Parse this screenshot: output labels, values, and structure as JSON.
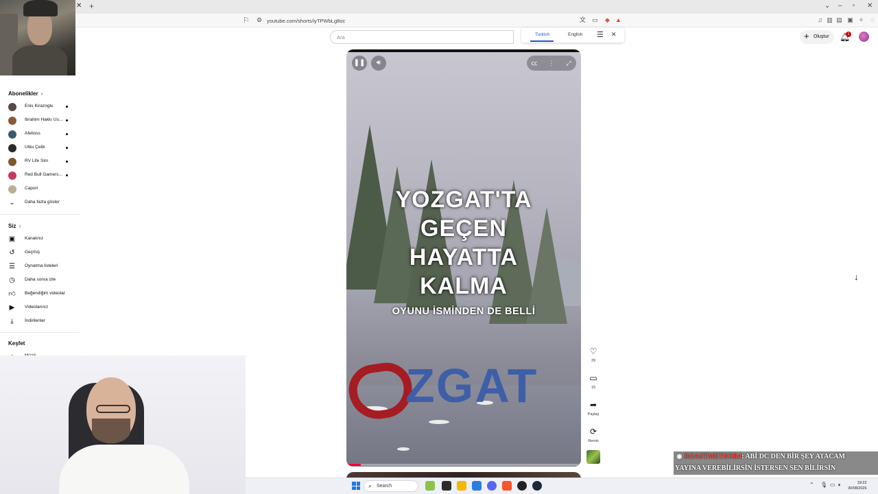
{
  "browser": {
    "url": "youtube.com/shorts/iyTPWbLg8oc"
  },
  "search": {
    "placeholder": "Ara"
  },
  "caption_menu": {
    "languages": [
      "Turkish",
      "English"
    ],
    "active": "Turkish"
  },
  "header": {
    "create_label": "Oluştur",
    "notification_count": "1"
  },
  "sidebar": {
    "subscriptions_title": "Abonelikler",
    "subscriptions": [
      {
        "label": "Enis Kirazoglu",
        "color": "#5a4a44",
        "new": true
      },
      {
        "label": "İbrahim Hakkı Us...",
        "color": "#8a5a3c",
        "new": true
      },
      {
        "label": "Afelioss",
        "color": "#3b5a6a",
        "new": true
      },
      {
        "label": "Utku Çelik",
        "color": "#2a2a2a",
        "new": true
      },
      {
        "label": "RV Life Sim",
        "color": "#7a5a2a",
        "new": true
      },
      {
        "label": "Red Bull Gamers...",
        "color": "#c43a5a",
        "new": true
      },
      {
        "label": "Capori",
        "color": "#b8b090",
        "new": false
      }
    ],
    "show_more": "Daha fazla göster",
    "you_title": "Siz",
    "you_items": [
      {
        "label": "Kanalınız",
        "icon": "account-box-icon"
      },
      {
        "label": "Geçmiş",
        "icon": "history-icon"
      },
      {
        "label": "Oynatma listeleri",
        "icon": "playlist-icon"
      },
      {
        "label": "Daha sonra izle",
        "icon": "clock-icon"
      },
      {
        "label": "Beğendiğim videolar",
        "icon": "thumbs-up-icon"
      },
      {
        "label": "Videolarınız",
        "icon": "video-icon"
      },
      {
        "label": "İndirilenler",
        "icon": "download-icon"
      }
    ],
    "explore_title": "Keşfet",
    "explore_items": [
      {
        "label": "Müzik",
        "icon": "music-icon"
      }
    ]
  },
  "player": {
    "overlay_lines": [
      "YOZGAT'TA",
      "GEÇEN",
      "HAYATTA",
      "KALMA"
    ],
    "overlay_sub": "OYUNU İSMİNDEN DE BELLİ",
    "sign_text": "ZGAT",
    "progress": 0.06
  },
  "actions": {
    "likes": "29",
    "comments": "15",
    "share_label": "Paylaş",
    "remix_label": "Remix"
  },
  "chat": {
    "username": "ROASTMETEOR4",
    "line1": ": ABİ DC DEN BİR ŞEY ATACAM",
    "line2": "YAYINA VEREBİLİRSİN İSTERSEN SEN BİLİRSİN"
  },
  "taskbar": {
    "search_label": "Search",
    "time": "18:22",
    "date": "30/08/2026"
  },
  "colors": {
    "accent": "#1a56c4",
    "progress": "#ff0033",
    "chat_user": "#ff4b3a"
  }
}
